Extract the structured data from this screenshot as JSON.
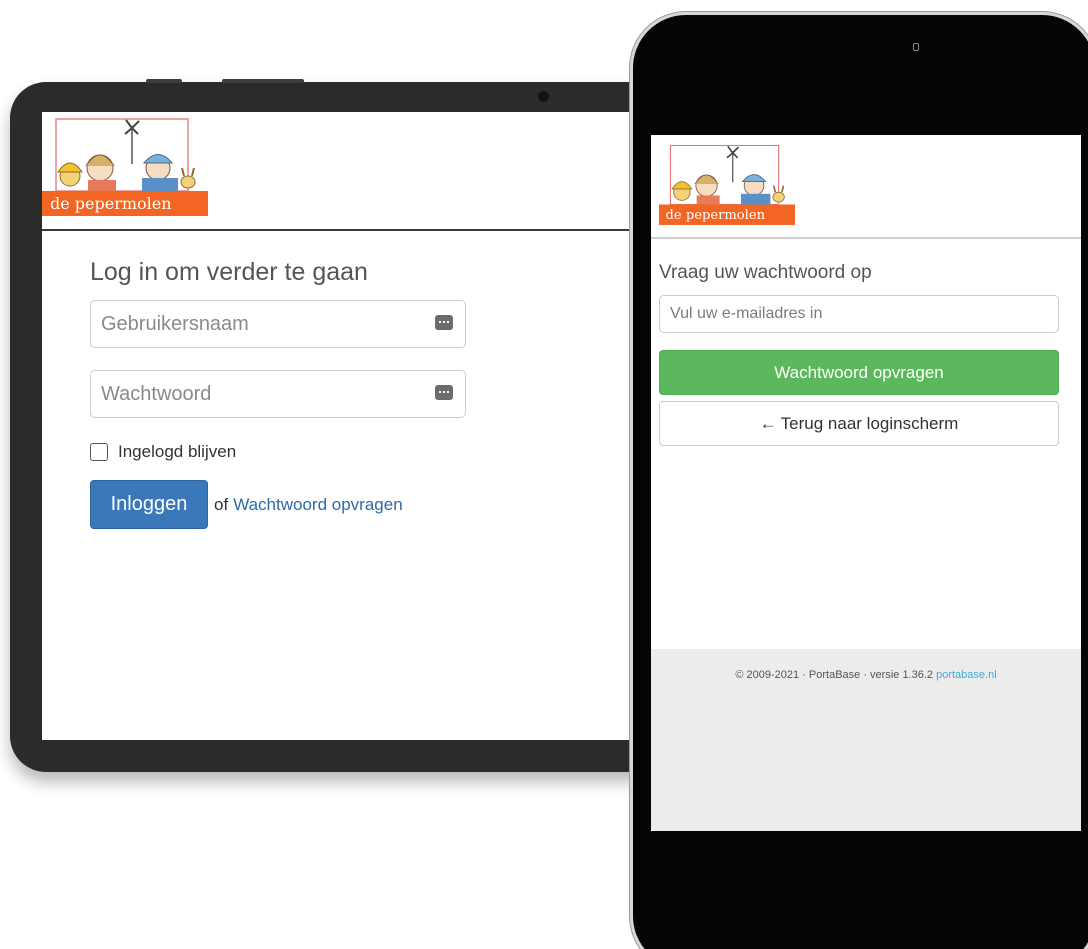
{
  "tablet": {
    "logo": {
      "text": "de pepermolen",
      "color": "#f26522"
    },
    "form": {
      "title": "Log in om verder te gaan",
      "username_placeholder": "Gebruikersnaam",
      "password_placeholder": "Wachtwoord",
      "input_icon": "password-manager-icon",
      "remember_label": "Ingelogd blijven",
      "remember_checked": false,
      "login_button": "Inloggen",
      "or_text": "of",
      "forgot_link": "Wachtwoord opvragen",
      "primary_color": "#3a78b9",
      "link_color": "#2e6aa7"
    }
  },
  "phone": {
    "logo": {
      "text": "de pepermolen",
      "color": "#f26522"
    },
    "form": {
      "title": "Vraag uw wachtwoord op",
      "email_placeholder": "Vul uw e-mailadres in",
      "submit_button": "Wachtwoord opvragen",
      "back_icon": "arrow-left-icon",
      "back_button": "Terug naar loginscherm",
      "submit_color": "#5cb85c"
    },
    "footer": {
      "text": "© 2009-2021 · PortaBase · versie 1.36.2",
      "link": "portabase.nl",
      "link_color": "#3aaee0"
    }
  }
}
